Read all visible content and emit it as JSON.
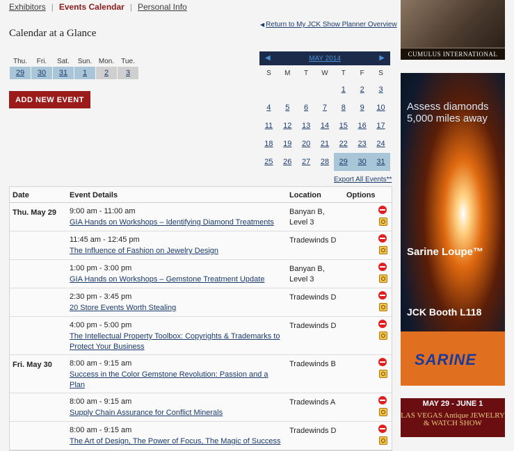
{
  "nav": {
    "exhibitors": "Exhibitors",
    "events_calendar": "Events Calendar",
    "personal_info": "Personal Info",
    "sep": "|"
  },
  "page_title": "Calendar at a Glance",
  "return_link": "Return to My JCK Show Planner Overview",
  "week": {
    "days": [
      "Thu.",
      "Fri.",
      "Sat.",
      "Sun.",
      "Mon.",
      "Tue."
    ],
    "dates": [
      "29",
      "30",
      "31",
      "1",
      "2",
      "3"
    ]
  },
  "add_event_label": "ADD NEW EVENT",
  "calendar": {
    "month": "MAY 2014",
    "prev": "◀",
    "next": "▶",
    "weekdays": [
      "S",
      "M",
      "T",
      "W",
      "T",
      "F",
      "S"
    ],
    "weeks": [
      [
        "",
        "",
        "",
        "",
        "1",
        "2",
        "3"
      ],
      [
        "4",
        "5",
        "6",
        "7",
        "8",
        "9",
        "10"
      ],
      [
        "11",
        "12",
        "13",
        "14",
        "15",
        "16",
        "17"
      ],
      [
        "18",
        "19",
        "20",
        "21",
        "22",
        "23",
        "24"
      ],
      [
        "25",
        "26",
        "27",
        "28",
        "29",
        "30",
        "31"
      ]
    ],
    "highlight_color": "#a9c6d8"
  },
  "export_link": "Export All Events**",
  "events_table": {
    "headers": {
      "date": "Date",
      "details": "Event Details",
      "location": "Location",
      "options": "Options"
    },
    "rows": [
      {
        "date": "Thu. May 29",
        "time": "9:00 am - 11:00 am",
        "title": "GIA Hands on Workshops – Identifying Diamond Treatments",
        "location": "Banyan B, Level 3"
      },
      {
        "date": "",
        "time": "11:45 am - 12:45 pm",
        "title": "The Influence of Fashion on Jewelry Design",
        "location": "Tradewinds D"
      },
      {
        "date": "",
        "time": "1:00 pm - 3:00 pm",
        "title": "GIA Hands on Workshops – Gemstone Treatment Update",
        "location": "Banyan B, Level 3"
      },
      {
        "date": "",
        "time": "2:30 pm - 3:45 pm",
        "title": "20 Store Events Worth Stealing",
        "location": "Tradewinds D"
      },
      {
        "date": "",
        "time": "4:00 pm - 5:00 pm",
        "title": "The Intellectual Property Toolbox: Copyrights & Trademarks to Protect Your Business",
        "location": "Tradewinds D"
      },
      {
        "date": "Fri. May 30",
        "time": "8:00 am - 9:15 am",
        "title": "Success in the Color Gemstone Revolution: Passion and a Plan",
        "location": "Tradewinds B"
      },
      {
        "date": "",
        "time": "8:00 am - 9:15 am",
        "title": "Supply Chain Assurance for Conflict Minerals",
        "location": "Tradewinds A"
      },
      {
        "date": "",
        "time": "8:00 am - 9:15 am",
        "title": "The Art of Design, The Power of Focus, The Magic of Success",
        "location": "Tradewinds D"
      }
    ]
  },
  "ads": {
    "cumulus": "CUMULUS INTERNATIONAL",
    "sarine_tagline": "Assess diamonds 5,000 miles away",
    "sarine_product": "Sarine Loupe™",
    "sarine_booth": "JCK Booth L118",
    "sarine_logo": "SARINE",
    "show_dates": "MAY 29 - JUNE 1",
    "show_name": "LAS VEGAS Antique JEWELRY & WATCH SHOW"
  }
}
